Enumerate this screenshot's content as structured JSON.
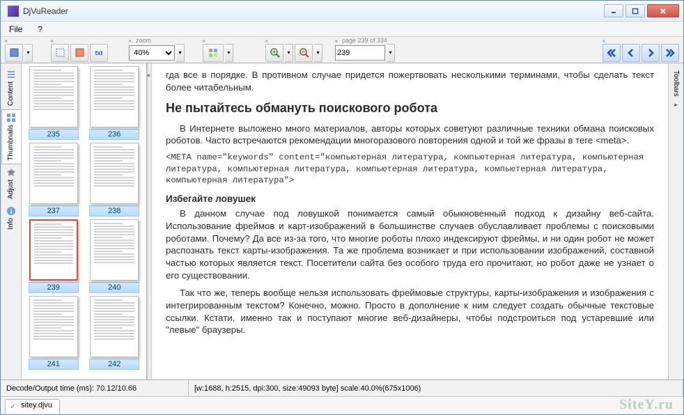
{
  "window": {
    "title": "DjVuReader"
  },
  "menu": {
    "file": "File",
    "help": "?"
  },
  "toolbar": {
    "zoom_label": "zoom",
    "zoom_value": "40%",
    "page_label": "page 239 of 334",
    "page_value": "239"
  },
  "sidetabs": {
    "content": "Content",
    "thumbnails": "Thumbnails",
    "adjust": "Adjust",
    "info": "Info"
  },
  "rightbar": {
    "toolbars": "Toolbars"
  },
  "thumbnails": [
    {
      "n": "235"
    },
    {
      "n": "236"
    },
    {
      "n": "237"
    },
    {
      "n": "238"
    },
    {
      "n": "239",
      "selected": true
    },
    {
      "n": "240"
    },
    {
      "n": "241"
    },
    {
      "n": "242"
    }
  ],
  "document": {
    "frag1": "гда все в порядке. В противном случае придется пожертвовать несколькими терминами, чтобы сделать текст более читабельным.",
    "h2": "Не пытайтесь обмануть поискового робота",
    "p1": "В Интернете выложено много материалов, авторы которых советуют различные техники обмана поисковых роботов. Часто встречаются рекомендации многоразового повторения одной и той же фразы в теге <meta>.",
    "code": "<META name=\"keywords\" content=\"компьютерная литература, компьютерная литература, компьютерная литература, компьютерная литература, компьютерная литература, компьютерная литература, компьютерная литература\">",
    "h3": "Избегайте ловушек",
    "p2": "В данном случае под ловушкой понимается самый обыкновенный подход к дизайну веб-сайта. Использование фреймов и карт-изображений в большинстве случаев обуславливает проблемы с поисковыми роботами. Почему? Да все из-за того, что многие роботы плохо индексируют фреймы, и ни один робот не может распознать текст карты-изображения. Та же проблема возникает и при использовании изображений, составной частью которых является текст. Посетители сайта без особого труда его прочитают, но робот даже не узнает о его существовании.",
    "p3": "Так что же, теперь вообще нельзя использовать фреймовые структуры, карты-изображения и изображения с интегрированным текстом? Конечно, можно. Просто в дополнение к ним следует создать обычные текстовые ссылки. Кстати, именно так и поступают многие веб-дизайнеры, чтобы подстроиться под устаревшие или \"левые\" браузеры."
  },
  "status": {
    "left": "Decode/Output time (ms): 70.12/10.66",
    "right": "[w:1688, h:2515, dpi:300, size:49093 byte] scale:40.0%(675x1006)"
  },
  "doctab": {
    "name": "sitey.djvu"
  },
  "watermark": "SiteY.ru"
}
